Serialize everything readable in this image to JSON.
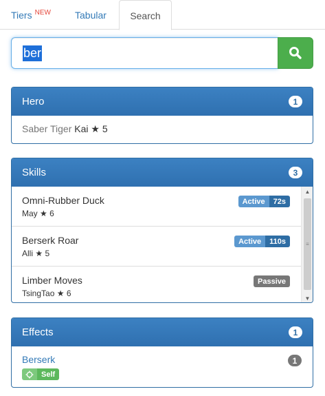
{
  "tabs": {
    "tiers": "Tiers",
    "tiers_badge": "NEW",
    "tabular": "Tabular",
    "search": "Search"
  },
  "search": {
    "value": "ber",
    "button_icon": "search-icon"
  },
  "hero_panel": {
    "title": "Hero",
    "count": "1",
    "skill": "Saber Tiger",
    "name": "Kai",
    "star": "★",
    "stars": "5"
  },
  "skills_panel": {
    "title": "Skills",
    "count": "3",
    "items": [
      {
        "title": "Omni-Rubber Duck",
        "hero": "May",
        "star": "★",
        "stars": "6",
        "type": "Active",
        "cooldown": "72s"
      },
      {
        "title": "Berserk Roar",
        "hero": "Alli",
        "star": "★",
        "stars": "5",
        "type": "Active",
        "cooldown": "110s"
      },
      {
        "title": "Limber Moves",
        "hero": "TsingTao",
        "star": "★",
        "stars": "6",
        "type": "Passive"
      }
    ]
  },
  "effects_panel": {
    "title": "Effects",
    "count": "1",
    "items": [
      {
        "name": "Berserk",
        "target": "Self",
        "target_icon": "crosshair-icon",
        "count": "1"
      }
    ]
  },
  "colors": {
    "panel_header": "#2f70b0",
    "search_button": "#4cae4c",
    "new_badge": "#e5473b",
    "active_tag": "#5b98cf",
    "cooldown_tag": "#2e6da4",
    "passive_tag": "#777777",
    "self_tag": "#5cb85c"
  }
}
